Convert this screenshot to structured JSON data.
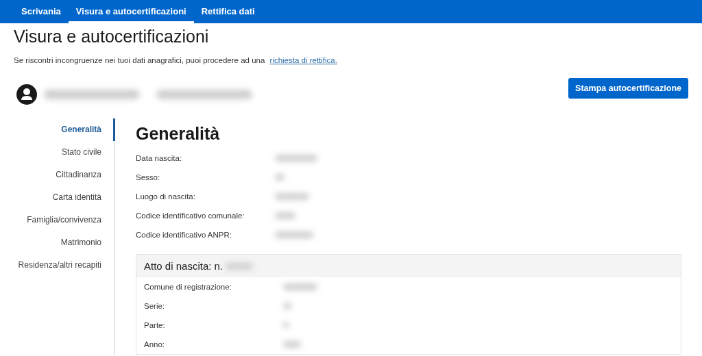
{
  "nav_tabs": [
    {
      "label": "Scrivania",
      "selected": false
    },
    {
      "label": "Visura e autocertificazioni",
      "selected": true
    },
    {
      "label": "Rettifica dati",
      "selected": false
    }
  ],
  "page_title": "Visura e autocertificazioni",
  "intro": {
    "text": "Se riscontri incongruenze nei tuoi dati anagrafici, puoi procedere ad una",
    "link": "richiesta di rettifica."
  },
  "print_button": "Stampa autocertificazione",
  "sidebar": {
    "items": [
      {
        "label": "Generalità",
        "selected": true
      },
      {
        "label": "Stato civile",
        "selected": false
      },
      {
        "label": "Cittadinanza",
        "selected": false
      },
      {
        "label": "Carta identità",
        "selected": false
      },
      {
        "label": "Famiglia/convivenza",
        "selected": false
      },
      {
        "label": "Matrimonio",
        "selected": false
      },
      {
        "label": "Residenza/altri recapiti",
        "selected": false
      }
    ]
  },
  "section_title": "Generalità",
  "fields": [
    {
      "label": "Data nascita:"
    },
    {
      "label": "Sesso:"
    },
    {
      "label": "Luogo di nascita:"
    },
    {
      "label": "Codice identificativo comunale:"
    },
    {
      "label": "Codice identificativo ANPR:"
    }
  ],
  "birth_record": {
    "title": "Atto di nascita: n.",
    "fields": [
      {
        "label": "Comune di registrazione:"
      },
      {
        "label": "Serie:"
      },
      {
        "label": "Parte:"
      },
      {
        "label": "Anno:"
      }
    ]
  }
}
